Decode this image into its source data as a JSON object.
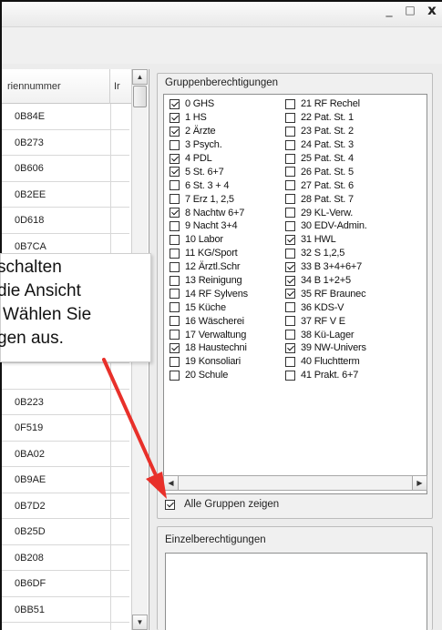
{
  "window": {
    "controls": {
      "minimize": "_",
      "maximize": "□",
      "close": "x"
    }
  },
  "grid": {
    "columns": [
      "riennummer",
      "Ir"
    ],
    "rows": [
      "0B84E",
      "0B273",
      "0B606",
      "0B2EE",
      "0D618",
      "0B7CA",
      "",
      "",
      "",
      "",
      "",
      "0B223",
      "0F519",
      "0BA02",
      "0B9AE",
      "0B7D2",
      "0B25D",
      "0B208",
      "0B6DF",
      "0BB51",
      ""
    ]
  },
  "tooltip": {
    "lines": [
      "schalten",
      "die Ansicht",
      "Wählen Sie",
      "gen aus."
    ]
  },
  "group_permissions": {
    "title": "Gruppenberechtigungen",
    "left": [
      {
        "label": "0 GHS",
        "checked": true
      },
      {
        "label": "1 HS",
        "checked": true
      },
      {
        "label": "2 Ärzte",
        "checked": true
      },
      {
        "label": "3 Psych.",
        "checked": false
      },
      {
        "label": "4 PDL",
        "checked": true
      },
      {
        "label": "5 St. 6+7",
        "checked": true
      },
      {
        "label": "6 St. 3 + 4",
        "checked": false
      },
      {
        "label": "7 Erz 1, 2,5",
        "checked": false
      },
      {
        "label": "8 Nachtw 6+7",
        "checked": true
      },
      {
        "label": "9 Nacht 3+4",
        "checked": false
      },
      {
        "label": "10 Labor",
        "checked": false
      },
      {
        "label": "11 KG/Sport",
        "checked": false
      },
      {
        "label": "12 Ärztl.Schr",
        "checked": false
      },
      {
        "label": "13 Reinigung",
        "checked": false
      },
      {
        "label": "14 RF Sylvens",
        "checked": false
      },
      {
        "label": "15 Küche",
        "checked": false
      },
      {
        "label": "16 Wäscherei",
        "checked": false
      },
      {
        "label": "17 Verwaltung",
        "checked": false
      },
      {
        "label": "18 Haustechni",
        "checked": true
      },
      {
        "label": "19 Konsoliari",
        "checked": false
      },
      {
        "label": "20 Schule",
        "checked": false
      }
    ],
    "right": [
      {
        "label": "21 RF Rechel",
        "checked": false
      },
      {
        "label": "22 Pat. St. 1",
        "checked": false
      },
      {
        "label": "23 Pat. St. 2",
        "checked": false
      },
      {
        "label": "24 Pat. St. 3",
        "checked": false
      },
      {
        "label": "25 Pat. St. 4",
        "checked": false
      },
      {
        "label": "26 Pat. St. 5",
        "checked": false
      },
      {
        "label": "27 Pat. St. 6",
        "checked": false
      },
      {
        "label": "28 Pat. St. 7",
        "checked": false
      },
      {
        "label": "29 KL-Verw.",
        "checked": false
      },
      {
        "label": "30 EDV-Admin.",
        "checked": false
      },
      {
        "label": "31 HWL",
        "checked": true
      },
      {
        "label": "32 S 1,2,5",
        "checked": false
      },
      {
        "label": "33 B 3+4+6+7",
        "checked": true
      },
      {
        "label": "34 B 1+2+5",
        "checked": true
      },
      {
        "label": "35 RF Braunec",
        "checked": true
      },
      {
        "label": "36 KDS-V",
        "checked": false
      },
      {
        "label": "37 RF V E",
        "checked": false
      },
      {
        "label": "38 Kü-Lager",
        "checked": false
      },
      {
        "label": "39 NW-Univers",
        "checked": true
      },
      {
        "label": "40 Fluchtterm",
        "checked": false
      },
      {
        "label": "41 Prakt. 6+7",
        "checked": false
      }
    ],
    "show_all": {
      "label": "Alle Gruppen zeigen",
      "checked": true
    }
  },
  "individual_permissions": {
    "title": "Einzelberechtigungen"
  },
  "colors": {
    "annotation_arrow": "#e8302a"
  }
}
